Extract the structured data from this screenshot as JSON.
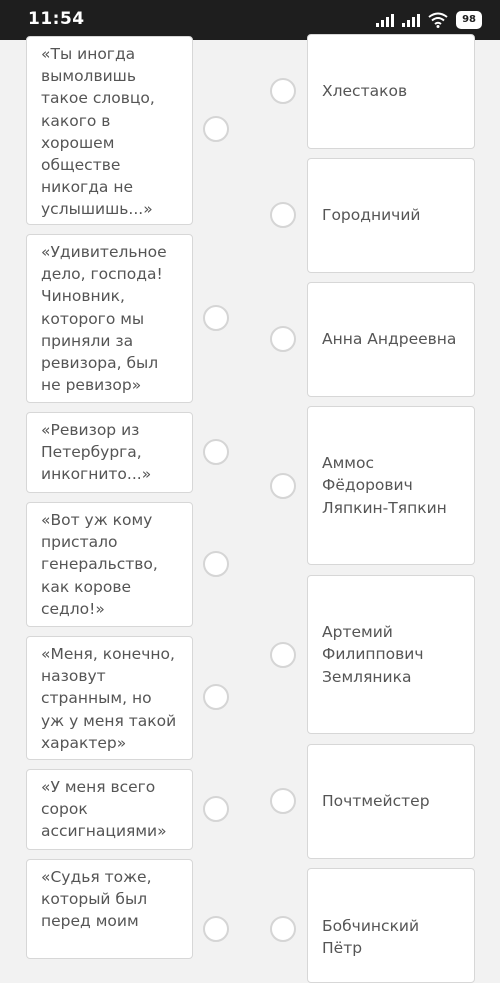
{
  "status_bar": {
    "time": "11:54",
    "battery": "98"
  },
  "quotes": [
    "«Ты иногда вымолвишь такое словцо, какого в хорошем обществе никогда не услышишь...»",
    "«Удивительное дело, господа! Чиновник, которого мы приняли за ревизора, был не ревизор»",
    "«Ревизор из Петербурга, инкогнито...»",
    "«Вот уж кому пристало генеральство, как корове седло!»",
    "«Меня, конечно, назовут странным, но уж у меня такой характер»",
    "«У меня всего сорок ассигнациями»",
    "«Судья тоже, который был перед моим"
  ],
  "characters": [
    "Хлестаков",
    "Городничий",
    "Анна Андреевна",
    "Аммос Фёдорович Ляпкин-Тяпкин",
    "Артемий Филиппович Земляника",
    "Почтмейстер",
    "Бобчинский Пётр"
  ],
  "colors": {
    "background": "#f2f2f2",
    "card": "#ffffff",
    "card_border": "#d7d7d7",
    "text": "#555555",
    "radio_border": "#d5d5d5",
    "status_bar": "#1e1e1e"
  }
}
